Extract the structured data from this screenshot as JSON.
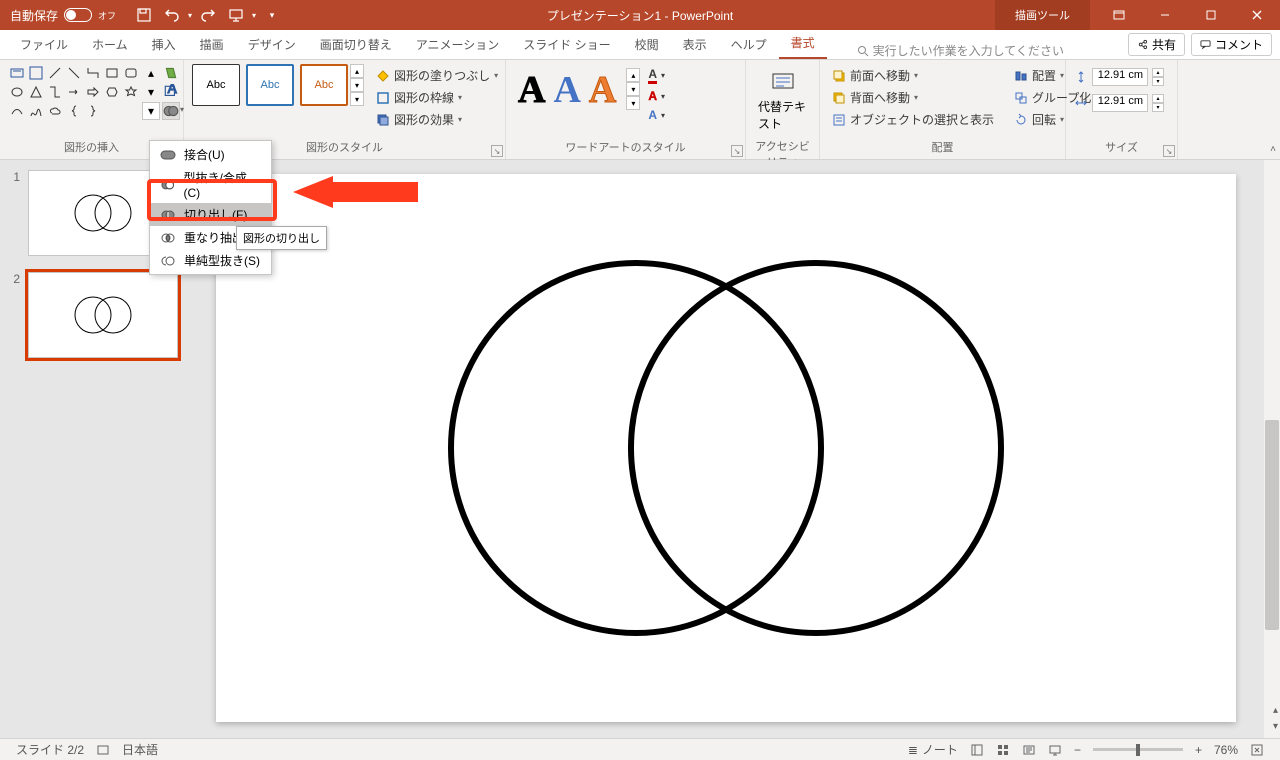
{
  "titlebar": {
    "autosave_label": "自動保存",
    "autosave_state": "オフ",
    "doc_title": "プレゼンテーション1 - PowerPoint",
    "tool_context": "描画ツール"
  },
  "tabs": {
    "file": "ファイル",
    "home": "ホーム",
    "insert": "挿入",
    "draw": "描画",
    "design": "デザイン",
    "transitions": "画面切り替え",
    "animations": "アニメーション",
    "slideshow": "スライド ショー",
    "review": "校閲",
    "view": "表示",
    "help": "ヘルプ",
    "format": "書式",
    "search_placeholder": "実行したい作業を入力してください",
    "share": "共有",
    "comments": "コメント"
  },
  "ribbon": {
    "insert_shapes_label": "図形の挿入",
    "shape_styles_label": "図形のスタイル",
    "wordart_styles_label": "ワードアートのスタイル",
    "accessibility_label": "アクセシビリティ",
    "arrange_label": "配置",
    "size_label": "サイズ",
    "sample_text": "Abc",
    "shape_fill": "図形の塗りつぶし",
    "shape_outline": "図形の枠線",
    "shape_effects": "図形の効果",
    "wa_sample": "A",
    "alt_text": "代替テキスト",
    "bring_forward": "前面へ移動",
    "send_backward": "背面へ移動",
    "selection_pane": "オブジェクトの選択と表示",
    "align": "配置",
    "group": "グループ化",
    "rotate": "回転",
    "height_value": "12.91 cm",
    "width_value": "12.91 cm"
  },
  "merge_menu": {
    "union": "接合(U)",
    "combine": "型抜き/合成(C)",
    "fragment": "切り出し(F)",
    "intersect": "重なり抽出(I)",
    "subtract": "単純型抜き(S)",
    "tooltip": "図形の切り出し"
  },
  "slides": {
    "num1": "1",
    "num2": "2"
  },
  "statusbar": {
    "slide_indicator": "スライド 2/2",
    "language": "日本語",
    "notes": "ノート",
    "zoom": "76%"
  }
}
